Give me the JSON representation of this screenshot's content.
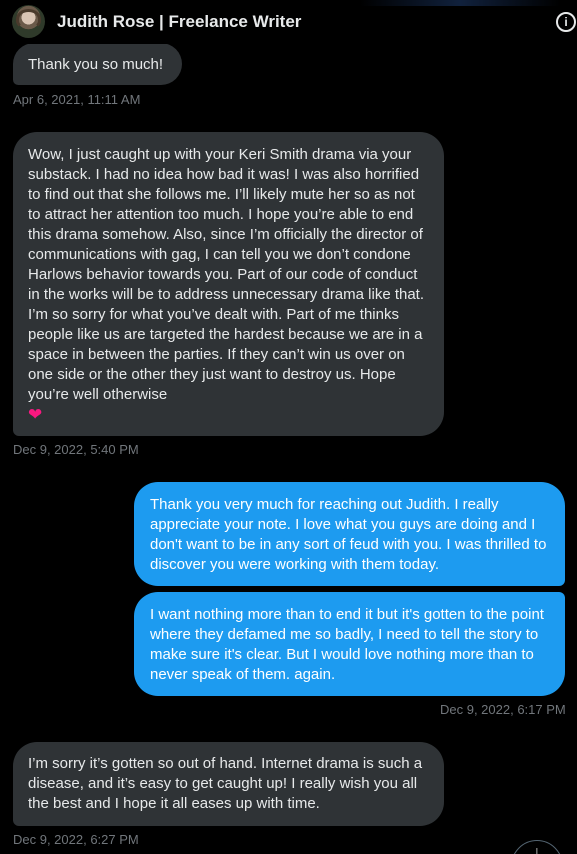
{
  "header": {
    "title": "Judith Rose | Freelance Writer",
    "info_icon": "info-icon",
    "info_glyph": "i"
  },
  "messages": [
    {
      "direction": "in",
      "text": "Thank you so much!",
      "timestamp": "Apr 6, 2021, 11:11 AM"
    },
    {
      "direction": "in",
      "text": "Wow, I just caught up with your Keri Smith drama via your substack. I had no idea how bad it was! I was also horrified to find out that she follows me. I’ll likely mute her so as not to attract her attention too much. I hope you’re able to end this drama somehow. Also, since I’m officially the director of communications with gag, I can tell you we don’t condone Harlows behavior towards you. Part of our code of conduct in the works will be to address unnecessary drama like that. I’m so sorry for what you’ve dealt with. Part of me thinks people like us are targeted the hardest because we are in a space in between the parties. If they can’t win us over on one side or the other they just want to destroy us. Hope you’re well otherwise",
      "emoji": "❤",
      "timestamp": "Dec 9, 2022, 5:40 PM"
    },
    {
      "direction": "out",
      "text": "Thank you very much for reaching out Judith. I really appreciate your note. I love what you guys are doing and I don't want to be in any sort of feud with you. I was thrilled to discover you were working with them today."
    },
    {
      "direction": "out",
      "text": "I want nothing more than to end it but it's gotten to the point where they defamed me so badly, I need to tell the story to make sure it's clear. But I would love nothing more than to never speak of them. again.",
      "timestamp": "Dec 9, 2022, 6:17 PM"
    },
    {
      "direction": "in",
      "text": "I’m sorry it’s gotten so out of hand. Internet drama is such a disease, and it’s easy to get caught up! I really wish you all the best and I hope it all eases up with time.",
      "timestamp": "Dec 9, 2022, 6:27 PM"
    }
  ],
  "scroll_button": {
    "icon": "arrow-down-icon",
    "glyph": "↓"
  },
  "colors": {
    "background": "#000000",
    "incoming_bubble": "#2f3336",
    "outgoing_bubble": "#1d9bf0",
    "timestamp": "#71767b",
    "heart": "#f91880"
  }
}
